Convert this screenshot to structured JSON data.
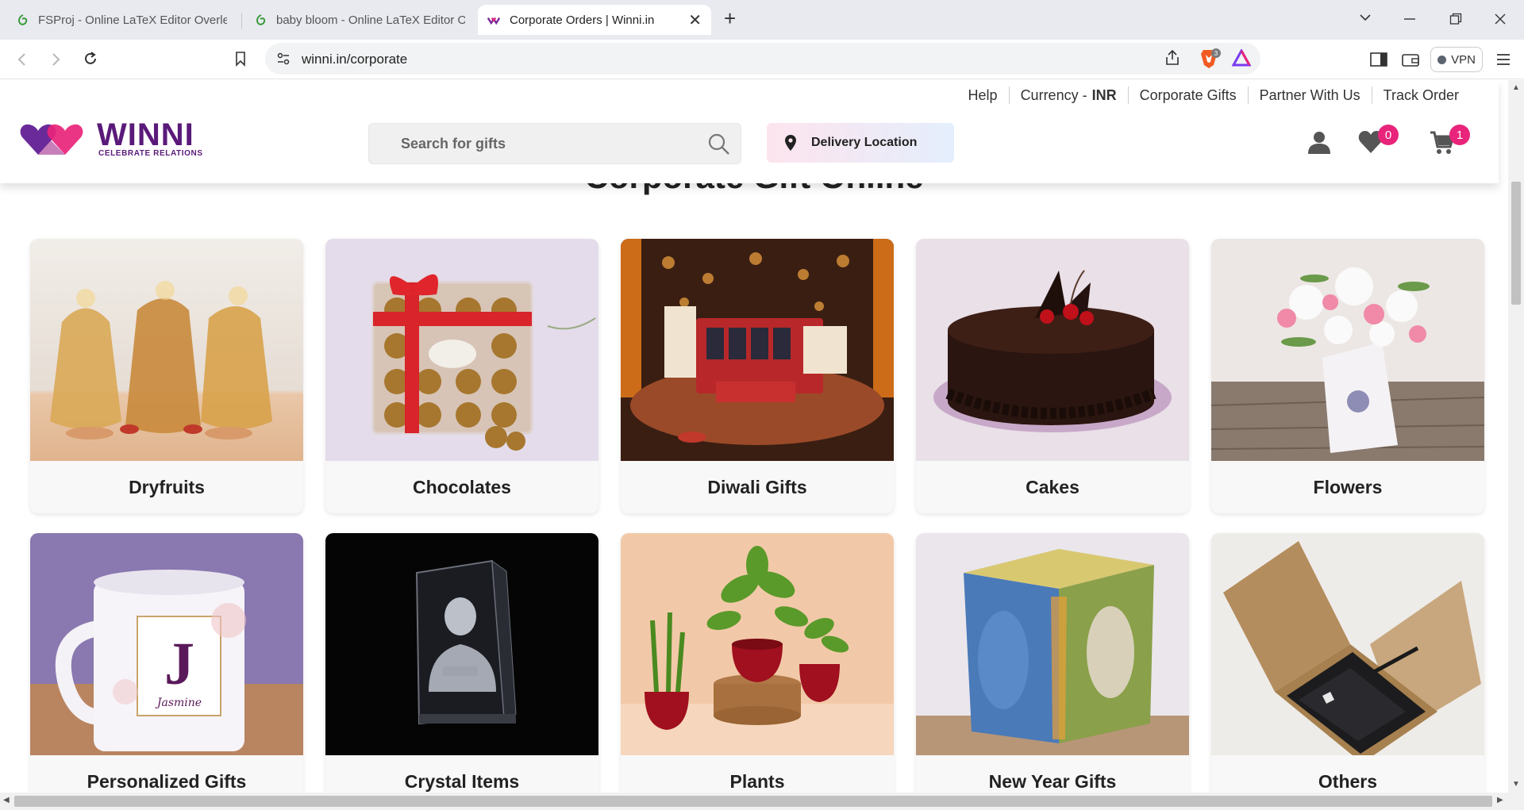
{
  "browser": {
    "tabs": [
      {
        "title": "FSProj - Online LaTeX Editor Overleaf",
        "active": false
      },
      {
        "title": "baby bloom - Online LaTeX Editor Ov",
        "active": false
      },
      {
        "title": "Corporate Orders | Winni.in",
        "active": true
      }
    ],
    "url": "winni.in/corporate",
    "brave_badge": "3",
    "vpn_label": "VPN"
  },
  "header": {
    "toplinks": {
      "help": "Help",
      "currency_label": "Currency -",
      "currency_value": "INR",
      "corporate_gifts": "Corporate Gifts",
      "partner": "Partner With Us",
      "track_order": "Track Order"
    },
    "logo": {
      "word": "WINNI",
      "tagline": "CELEBRATE RELATIONS"
    },
    "search_placeholder": "Search for gifts",
    "delivery_label": "Delivery Location",
    "wishlist_count": "0",
    "cart_count": "1",
    "colors": {
      "brand": "#5a1a7a",
      "accent": "#e8247b"
    }
  },
  "section_title": "Corporate Gift Online",
  "categories": [
    {
      "label": "Dryfruits",
      "image": "dryfruit-bags"
    },
    {
      "label": "Chocolates",
      "image": "ferrero-box"
    },
    {
      "label": "Diwali Gifts",
      "image": "diwali-hamper"
    },
    {
      "label": "Cakes",
      "image": "chocolate-cake"
    },
    {
      "label": "Flowers",
      "image": "flower-vase"
    },
    {
      "label": "Personalized Gifts",
      "image": "monogram-mug"
    },
    {
      "label": "Crystal Items",
      "image": "crystal-cube"
    },
    {
      "label": "Plants",
      "image": "potted-plants"
    },
    {
      "label": "New Year Gifts",
      "image": "buddha-lamp"
    },
    {
      "label": "Others",
      "image": "kraft-gift-box"
    }
  ],
  "mug_text": {
    "letter": "J",
    "name": "Jasmine"
  }
}
